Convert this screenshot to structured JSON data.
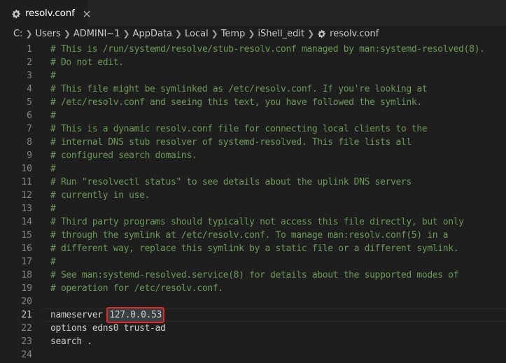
{
  "tab": {
    "title": "resolv.conf",
    "icon": "gear-icon",
    "close_icon": "close-icon"
  },
  "breadcrumb": {
    "items": [
      "C:",
      "Users",
      "ADMINI~1",
      "AppData",
      "Local",
      "Temp",
      "iShell_edit"
    ],
    "file": "resolv.conf",
    "file_icon": "gear-icon"
  },
  "editor": {
    "active_line": 21,
    "highlight_text": "127.0.0.53",
    "highlight_color": "#e02a2a",
    "comment_color": "#6a9955",
    "lines": [
      {
        "num": "1",
        "text": "# This is /run/systemd/resolve/stub-resolv.conf managed by man:systemd-resolved(8)."
      },
      {
        "num": "2",
        "text": "# Do not edit."
      },
      {
        "num": "3",
        "text": "#"
      },
      {
        "num": "4",
        "text": "# This file might be symlinked as /etc/resolv.conf. If you're looking at"
      },
      {
        "num": "5",
        "text": "# /etc/resolv.conf and seeing this text, you have followed the symlink."
      },
      {
        "num": "6",
        "text": "#"
      },
      {
        "num": "7",
        "text": "# This is a dynamic resolv.conf file for connecting local clients to the"
      },
      {
        "num": "8",
        "text": "# internal DNS stub resolver of systemd-resolved. This file lists all"
      },
      {
        "num": "9",
        "text": "# configured search domains."
      },
      {
        "num": "10",
        "text": "#"
      },
      {
        "num": "11",
        "text": "# Run \"resolvectl status\" to see details about the uplink DNS servers"
      },
      {
        "num": "12",
        "text": "# currently in use."
      },
      {
        "num": "13",
        "text": "#"
      },
      {
        "num": "14",
        "text": "# Third party programs should typically not access this file directly, but only"
      },
      {
        "num": "15",
        "text": "# through the symlink at /etc/resolv.conf. To manage man:resolv.conf(5) in a"
      },
      {
        "num": "16",
        "text": "# different way, replace this symlink by a static file or a different symlink."
      },
      {
        "num": "17",
        "text": "#"
      },
      {
        "num": "18",
        "text": "# See man:systemd-resolved.service(8) for details about the supported modes of"
      },
      {
        "num": "19",
        "text": "# operation for /etc/resolv.conf."
      },
      {
        "num": "20",
        "text": ""
      },
      {
        "num": "21",
        "text": "nameserver ",
        "highlight": "127.0.0.53"
      },
      {
        "num": "22",
        "text": "options edns0 trust-ad"
      },
      {
        "num": "23",
        "text": "search ."
      },
      {
        "num": "24",
        "text": ""
      }
    ]
  }
}
